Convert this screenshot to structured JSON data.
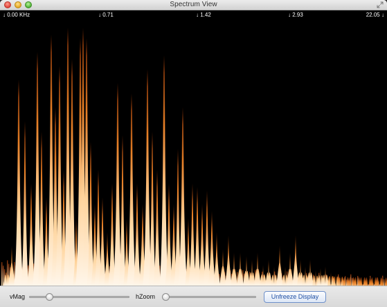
{
  "window": {
    "title": "Spectrum View"
  },
  "spectrum": {
    "freq_labels": [
      {
        "arrow": "↓",
        "text": "0.00 KHz"
      },
      {
        "arrow": "↓",
        "text": "0.71"
      },
      {
        "arrow": "↓",
        "text": "1.42"
      },
      {
        "arrow": "↓",
        "text": "2.93"
      },
      {
        "text": "22.05",
        "arrow": "↓"
      }
    ],
    "colors": {
      "background": "#000000",
      "low": "#5a1d02",
      "mid": "#d4701e",
      "high": "#ffe2b8",
      "peak": "#ffffff"
    }
  },
  "controls": {
    "vmag_label": "vMag",
    "hzoom_label": "hZoom",
    "vmag_level": 0.18,
    "hzoom_level": 0.0,
    "unfreeze_label": "Unfreeze Display"
  }
}
